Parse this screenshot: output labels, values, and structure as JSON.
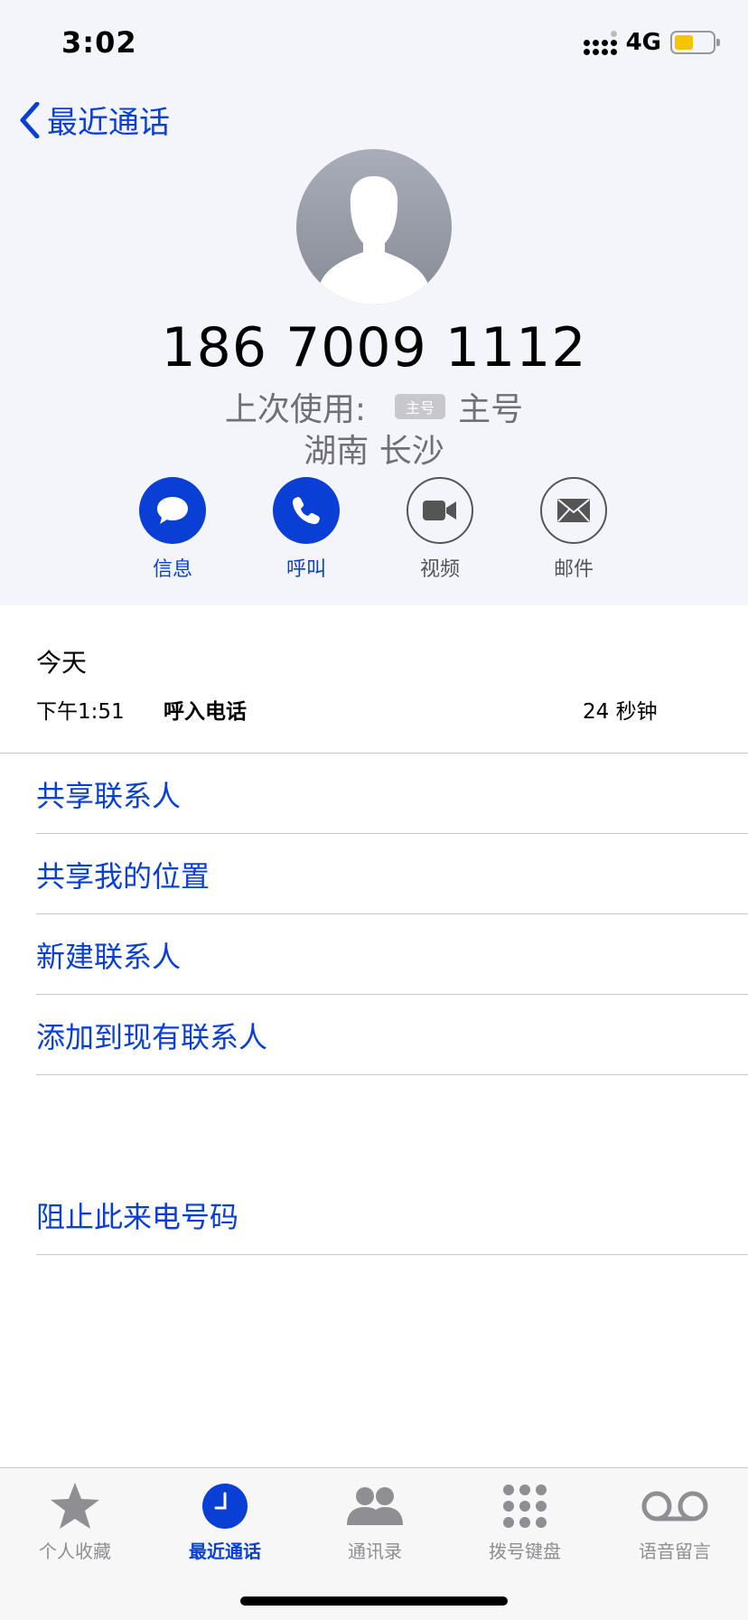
{
  "status_bar": {
    "time": "3:02",
    "network": "4G"
  },
  "nav": {
    "back_label": "最近通话"
  },
  "contact": {
    "number": "186 7009 1112",
    "last_used_label": "上次使用:",
    "sim_badge": "主号",
    "sim_name": "主号",
    "location": "湖南 长沙"
  },
  "actions": [
    {
      "label": "信息",
      "icon": "message-icon"
    },
    {
      "label": "呼叫",
      "icon": "phone-icon"
    },
    {
      "label": "视频",
      "icon": "video-icon"
    },
    {
      "label": "邮件",
      "icon": "mail-icon"
    }
  ],
  "history": {
    "day": "今天",
    "calls": [
      {
        "time": "下午1:51",
        "type": "呼入电话",
        "duration": "24 秒钟"
      }
    ]
  },
  "options": [
    "共享联系人",
    "共享我的位置",
    "新建联系人",
    "添加到现有联系人"
  ],
  "block": "阻止此来电号码",
  "tabs": [
    {
      "label": "个人收藏",
      "icon": "star-icon",
      "active": false
    },
    {
      "label": "最近通话",
      "icon": "clock-icon",
      "active": true
    },
    {
      "label": "通讯录",
      "icon": "contacts-icon",
      "active": false
    },
    {
      "label": "拨号键盘",
      "icon": "keypad-icon",
      "active": false
    },
    {
      "label": "语音留言",
      "icon": "voicemail-icon",
      "active": false
    }
  ],
  "colors": {
    "accent": "#0a3fd6",
    "header_bg": "#f4f5fa",
    "battery": "#f5c400"
  }
}
